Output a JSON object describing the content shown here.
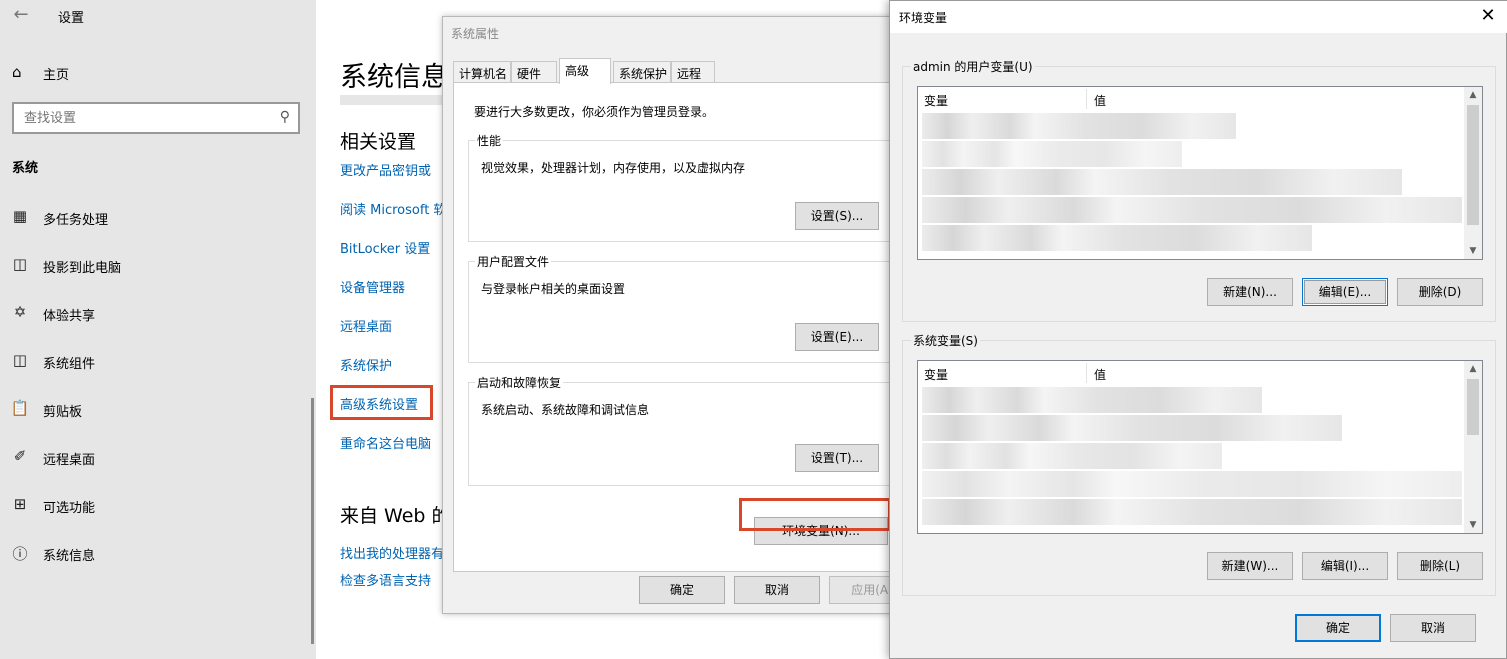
{
  "settings": {
    "title": "设置",
    "home": "主页",
    "search_placeholder": "查找设置",
    "section": "系统",
    "nav": [
      "多任务处理",
      "投影到此电脑",
      "体验共享",
      "系统组件",
      "剪贴板",
      "远程桌面",
      "可选功能",
      "系统信息"
    ],
    "page_title": "系统信息",
    "related_heading": "相关设置",
    "links": [
      "更改产品密钥或",
      "阅读 Microsoft 软",
      "BitLocker 设置",
      "设备管理器",
      "远程桌面",
      "系统保护",
      "高级系统设置",
      "重命名这台电脑"
    ],
    "web_heading": "来自 Web 的",
    "web_links": [
      "找出我的处理器有",
      "检查多语言支持"
    ],
    "highlight_color": "#d9472b",
    "link_color": "#0063b1"
  },
  "sysprop": {
    "title": "系统属性",
    "tabs": [
      "计算机名",
      "硬件",
      "高级",
      "系统保护",
      "远程"
    ],
    "active_tab": "高级",
    "note": "要进行大多数更改，你必须作为管理员登录。",
    "groups": [
      {
        "title": "性能",
        "desc": "视觉效果，处理器计划，内存使用，以及虚拟内存",
        "button": "设置(S)..."
      },
      {
        "title": "用户配置文件",
        "desc": "与登录帐户相关的桌面设置",
        "button": "设置(E)..."
      },
      {
        "title": "启动和故障恢复",
        "desc": "系统启动、系统故障和调试信息",
        "button": "设置(T)..."
      }
    ],
    "env_button": "环境变量(N)...",
    "ok": "确定",
    "cancel": "取消",
    "apply": "应用(A)"
  },
  "envvar": {
    "title": "环境变量",
    "user_section": "admin 的用户变量(U)",
    "system_section": "系统变量(S)",
    "col_var": "变量",
    "col_val": "值",
    "user_buttons": {
      "new": "新建(N)...",
      "edit": "编辑(E)...",
      "delete": "删除(D)"
    },
    "system_buttons": {
      "new": "新建(W)...",
      "edit": "编辑(I)...",
      "delete": "删除(L)"
    },
    "ok": "确定",
    "cancel": "取消"
  }
}
